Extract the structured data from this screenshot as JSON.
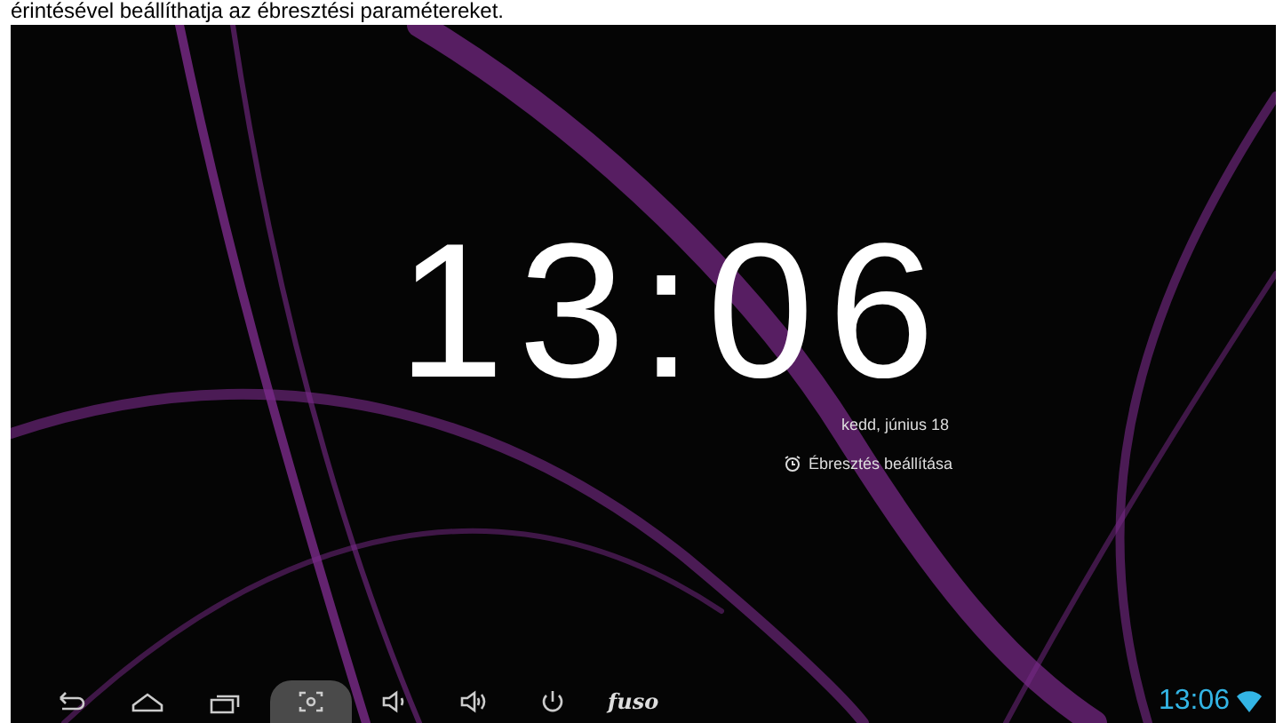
{
  "caption": "érintésével beállíthatja az ébresztési paramétereket.",
  "clock": {
    "time": "13:06",
    "date": "kedd, június 18",
    "alarm": "Ébresztés beállítása"
  },
  "navbar": {
    "buttons": [
      {
        "kind": "back",
        "selected": false
      },
      {
        "kind": "home",
        "selected": false
      },
      {
        "kind": "recent",
        "selected": false
      },
      {
        "kind": "screenshot",
        "selected": true
      },
      {
        "kind": "voldown",
        "selected": false
      },
      {
        "kind": "volup",
        "selected": false
      },
      {
        "kind": "power",
        "selected": false
      }
    ],
    "brand": "fuso"
  },
  "status": {
    "time": "13:06"
  }
}
